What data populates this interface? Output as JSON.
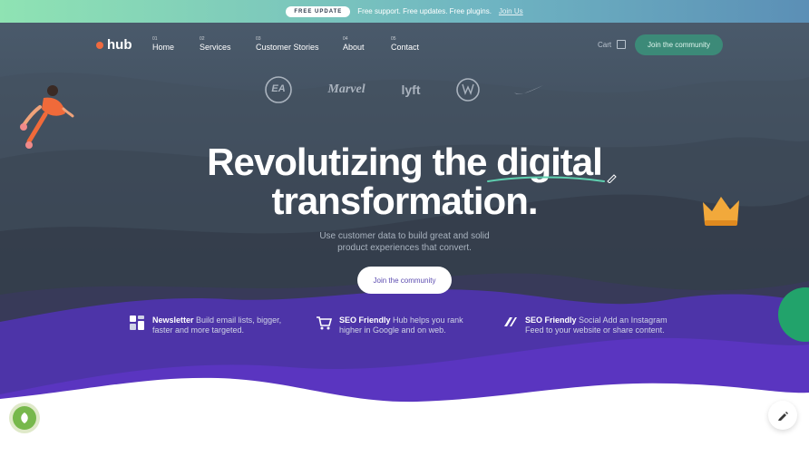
{
  "topbar": {
    "badge": "FREE UPDATE",
    "text": "Free support. Free updates. Free plugins.",
    "link": "Join Us"
  },
  "header": {
    "logo": "hub",
    "nav": [
      {
        "num": "01",
        "label": "Home"
      },
      {
        "num": "02",
        "label": "Services"
      },
      {
        "num": "03",
        "label": "Customer Stories"
      },
      {
        "num": "04",
        "label": "About"
      },
      {
        "num": "05",
        "label": "Contact"
      }
    ],
    "cart": "Cart",
    "cta": "Join the community"
  },
  "brands": [
    "EA",
    "Marvel",
    "lyft",
    "Volkswagen",
    "Nike"
  ],
  "hero": {
    "line1_prefix": "Revolutizing the ",
    "line1_highlight": "digital",
    "line2": "transformation.",
    "subtitle_line1": "Use customer data to build great and solid",
    "subtitle_line2": "product experiences that convert.",
    "cta": "Join the community"
  },
  "features": [
    {
      "title": "Newsletter",
      "line1": "Build email lists, bigger,",
      "line2": "faster and more targeted."
    },
    {
      "title": "SEO Friendly",
      "line1": "Hub helps you rank",
      "line2": "higher in Google and on web."
    },
    {
      "title": "SEO Friendly",
      "line1": "Social Add an Instagram",
      "line2": "Feed to your website or share content."
    }
  ],
  "colors": {
    "accent_green": "#3c8a78",
    "purple": "#5a35c0",
    "logo_dot": "#ef6a3f"
  },
  "icons": {
    "left_fab": "leaf-icon",
    "right_fab": "pencil-icon"
  }
}
